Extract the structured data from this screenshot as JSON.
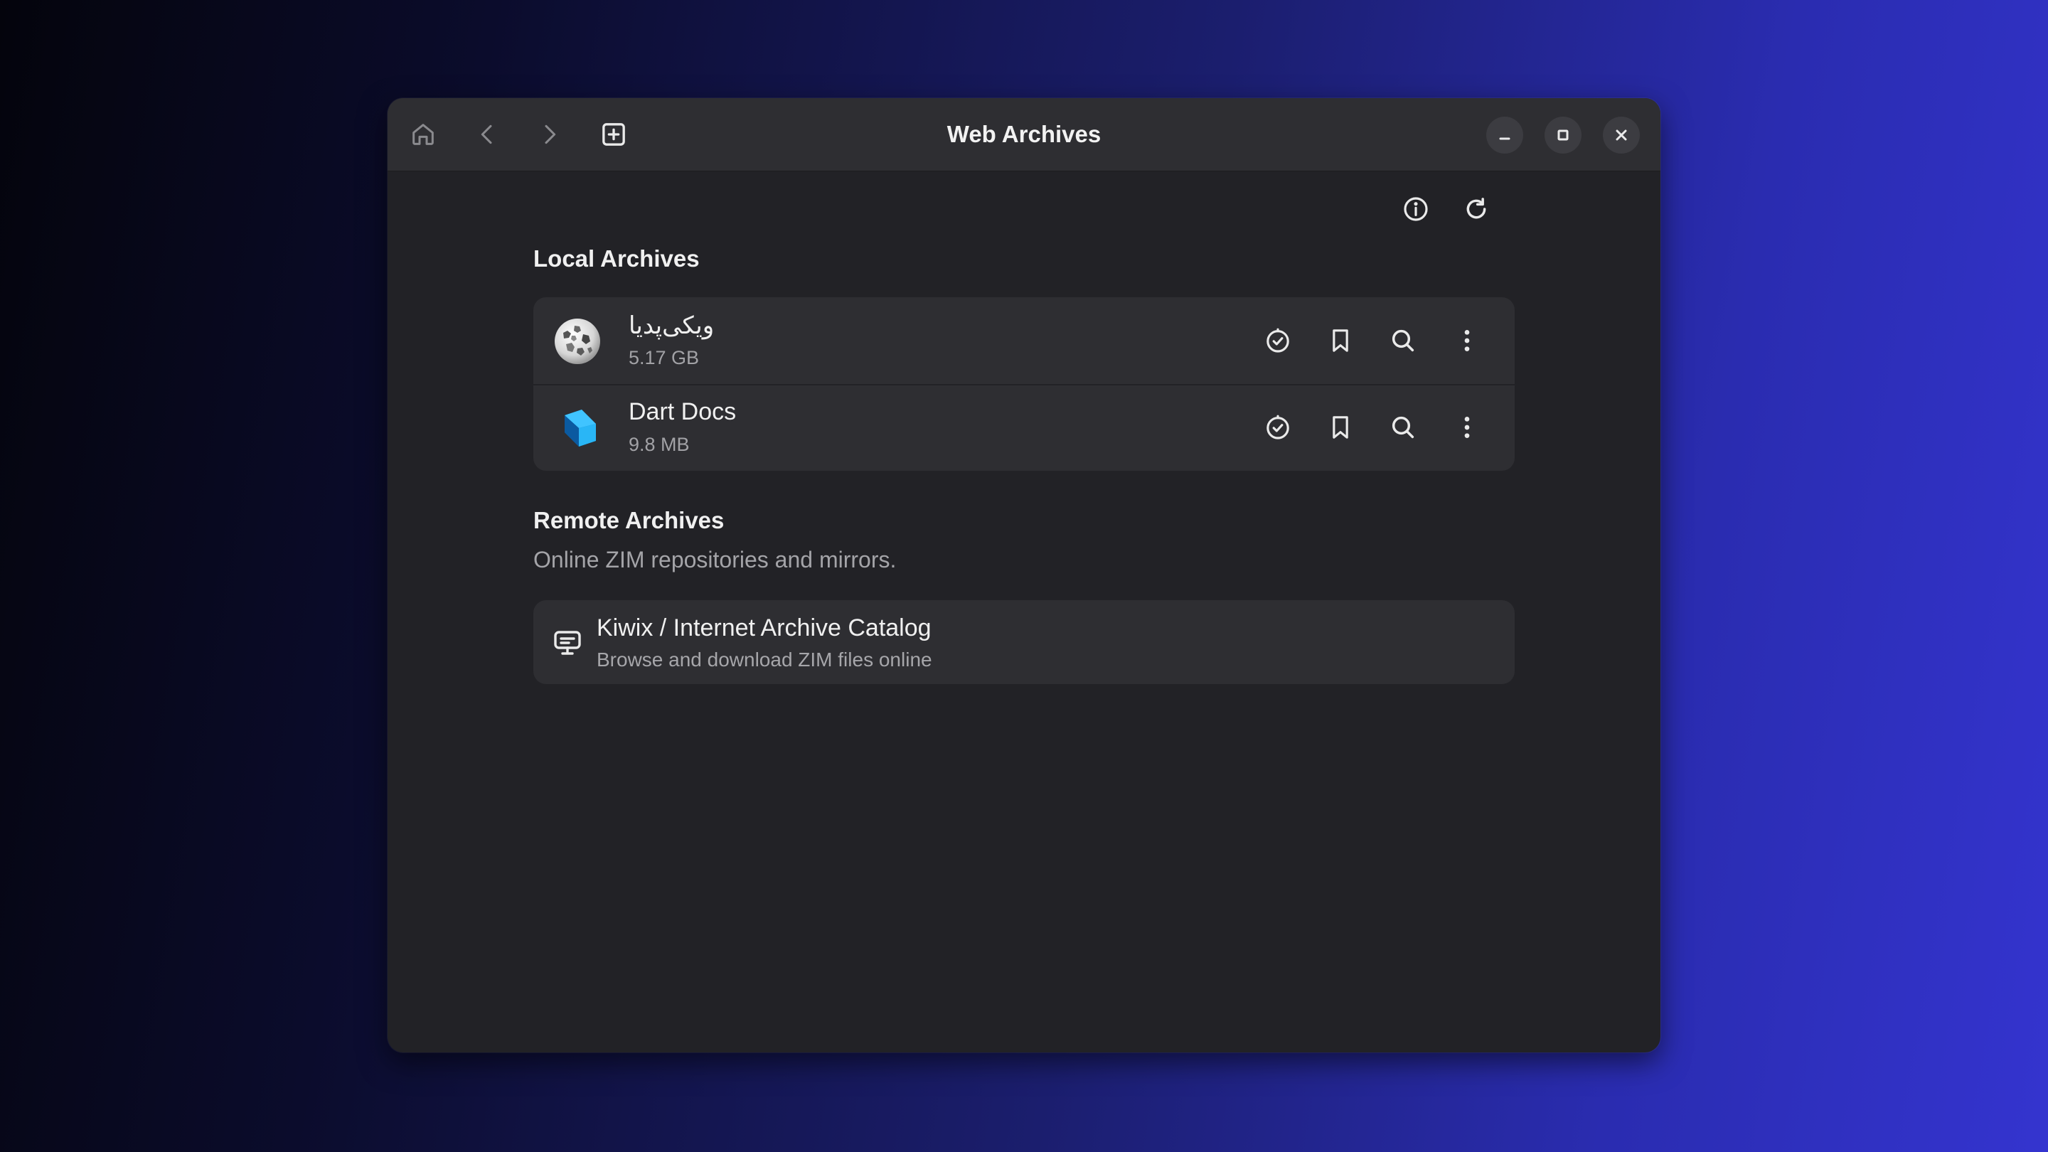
{
  "window": {
    "title": "Web Archives",
    "header_icons": [
      "home-icon",
      "back-icon",
      "forward-icon",
      "new-tab-icon"
    ],
    "controls": [
      "minimize-icon",
      "maximize-icon",
      "close-icon"
    ]
  },
  "local": {
    "title": "Local Archives",
    "actions": [
      "info-icon",
      "refresh-icon"
    ],
    "archives": [
      {
        "name": "ویکی‌پدیا",
        "size": "5.17 GB",
        "icon": "wikipedia-globe-icon"
      },
      {
        "name": "Dart Docs",
        "size": "9.8 MB",
        "icon": "dart-logo-icon"
      }
    ],
    "row_actions": [
      "check-circle-icon",
      "bookmark-icon",
      "search-icon",
      "more-vertical-icon"
    ]
  },
  "remote": {
    "title": "Remote Archives",
    "subtitle": "Online ZIM repositories and mirrors.",
    "catalog": {
      "title": "Kiwix / Internet Archive Catalog",
      "subtitle": "Browse and download ZIM files online",
      "icon": "catalog-icon"
    }
  },
  "colors": {
    "window_bg": "#222226",
    "headerbar_bg": "#2e2e32",
    "card_bg": "#2e2e32",
    "text_primary": "#f0f0f0",
    "text_secondary": "#a4a4a8",
    "dart_blue": "#0175c2",
    "dart_light": "#40c4ff"
  }
}
